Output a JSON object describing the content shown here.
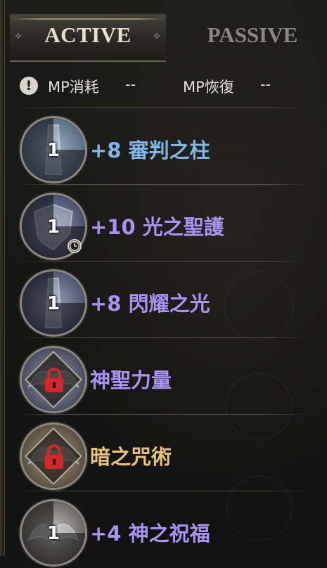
{
  "colors": {
    "blue": "#7fb8e8",
    "purple": "#a993f0",
    "gold": "#e7c27c",
    "lock_red": "#d4252a"
  },
  "tabs": {
    "active_label": "ACTIVE",
    "passive_label": "PASSIVE"
  },
  "mp": {
    "cost_label": "MP消耗",
    "cost_value": "--",
    "regen_label": "MP恢復",
    "regen_value": "--"
  },
  "skills": [
    {
      "level": "1",
      "enhance": "+8",
      "name": "審判之柱",
      "color": "blue",
      "locked": false,
      "icon": "pillar-skill-icon",
      "cooldown_icon": false
    },
    {
      "level": "1",
      "enhance": "+10",
      "name": "光之聖護",
      "color": "purple",
      "locked": false,
      "icon": "shield-skill-icon",
      "cooldown_icon": true
    },
    {
      "level": "1",
      "enhance": "+8",
      "name": "閃耀之光",
      "color": "purple",
      "locked": false,
      "icon": "radiance-skill-icon",
      "cooldown_icon": false
    },
    {
      "level": "",
      "enhance": "",
      "name": "神聖力量",
      "color": "purple",
      "locked": true,
      "icon": "wings-skill-icon",
      "cooldown_icon": false
    },
    {
      "level": "",
      "enhance": "",
      "name": "暗之咒術",
      "color": "gold",
      "locked": true,
      "icon": "curse-skill-icon",
      "cooldown_icon": false
    },
    {
      "level": "1",
      "enhance": "+4",
      "name": "神之祝福",
      "color": "purple",
      "locked": false,
      "icon": "blessing-skill-icon",
      "cooldown_icon": false
    }
  ]
}
